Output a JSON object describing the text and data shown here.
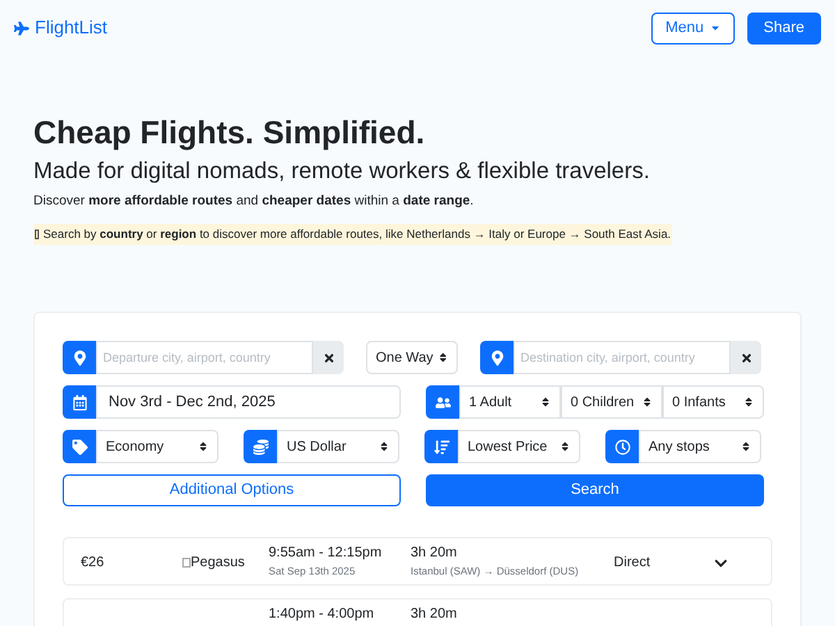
{
  "brand": "FlightList",
  "nav": {
    "menu": "Menu",
    "share": "Share"
  },
  "hero": {
    "title": "Cheap Flights. Simplified.",
    "subtitle": "Made for digital nomads, remote workers & flexible travelers.",
    "intro": "Discover **more affordable routes** and **cheaper dates** within a **date range**.",
    "tip": "Search by **country** or **region** to discover more affordable routes, like Netherlands → Italy or Europe → South East Asia."
  },
  "search": {
    "departure_placeholder": "Departure city, airport, country",
    "trip_type": "One Way",
    "destination_placeholder": "Destination city, airport, country",
    "dates": "Nov 3rd - Dec 2nd, 2025",
    "adults": "1 Adult",
    "children": "0 Children",
    "infants": "0 Infants",
    "cabin": "Economy",
    "currency": "US Dollar",
    "sort": "Lowest Price",
    "stops": "Any stops",
    "additional": "Additional Options",
    "submit": "Search"
  },
  "results": [
    {
      "price": "€26",
      "airline": "Pegasus",
      "times": "9:55am - 12:15pm",
      "date": "Sat Sep 13th 2025",
      "duration": "3h 20m",
      "route": "Istanbul (SAW) → Düsseldorf (DUS)",
      "stops": "Direct"
    },
    {
      "times": "1:40pm - 4:00pm",
      "duration": "3h 20m"
    }
  ]
}
